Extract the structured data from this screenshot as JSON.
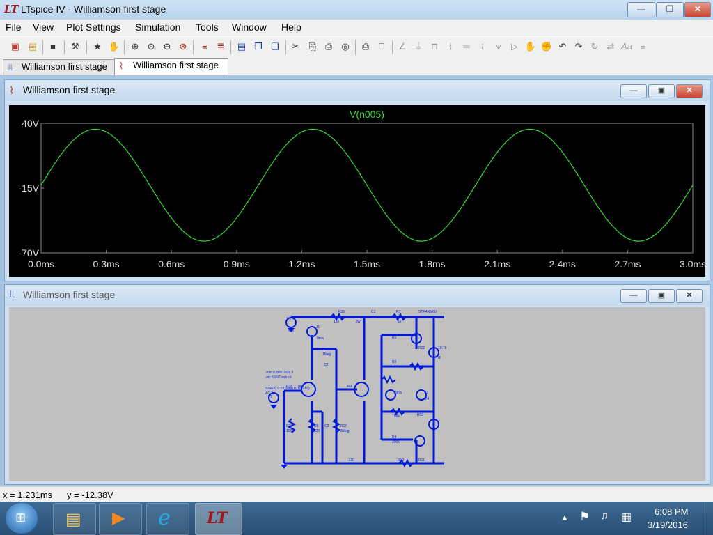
{
  "window": {
    "title": "LTspice IV - Williamson first stage",
    "logo": "LT"
  },
  "menu": [
    "File",
    "View",
    "Plot Settings",
    "Simulation",
    "Tools",
    "Window",
    "Help"
  ],
  "tabs": [
    {
      "label": "Williamson first stage",
      "icon": "schematic-icon",
      "active": false
    },
    {
      "label": "Williamson first stage",
      "icon": "waveform-icon",
      "active": true
    }
  ],
  "plot_window": {
    "title": "Williamson first stage"
  },
  "schematic_window": {
    "title": "Williamson first stage"
  },
  "chart_data": {
    "type": "line",
    "title": "V(n005)",
    "xlabel": "",
    "ylabel": "",
    "xlim": [
      0.0,
      3.0
    ],
    "ylim": [
      -70,
      40
    ],
    "x_ticks": [
      "0.0ms",
      "0.3ms",
      "0.6ms",
      "0.9ms",
      "1.2ms",
      "1.5ms",
      "1.8ms",
      "2.1ms",
      "2.4ms",
      "2.7ms",
      "3.0ms"
    ],
    "y_ticks": [
      "40V",
      "-15V",
      "-70V"
    ],
    "grid": false,
    "series": [
      {
        "name": "V(n005)",
        "color": "#33dd33",
        "x": [
          0.0,
          0.25,
          0.5,
          0.75,
          1.0,
          1.25,
          1.5,
          1.75,
          2.0,
          2.25,
          2.5,
          2.75,
          3.0
        ],
        "y": [
          -12.4,
          35.0,
          -12.4,
          -60.0,
          -12.4,
          35.0,
          -12.4,
          -60.0,
          -12.4,
          35.0,
          -12.4,
          -60.0,
          -12.4
        ]
      }
    ]
  },
  "schematic": {
    "directives": [
      ".tran 0.000 .003 .1",
      ".inc 6SN7.sub.cir",
      "SINE(0 0.03 1000 0 0 0 210)",
      "AC 1"
    ],
    "labels": [
      "V1",
      "450",
      "I1",
      "9ma",
      "R35",
      "12k",
      "2w",
      "C1",
      "R7",
      "1k",
      "STP4NM60",
      "R12",
      "1Meg",
      "C2",
      "R18",
      "1k",
      "V2",
      "R13",
      "100k",
      "R6",
      "820",
      "C3",
      "R17",
      "8Meg",
      "R3",
      "R5",
      "R9",
      "150k",
      "R4",
      "200k",
      "R33",
      "10.7k",
      "I2",
      "5ma",
      "V3",
      "V4",
      "-120",
      "R10",
      "R11",
      "R22"
    ]
  },
  "status": {
    "x": "x = 1.231ms",
    "y": "y = -12.38V"
  },
  "tray": {
    "time": "6:08 PM",
    "date": "3/19/2016"
  },
  "colors": {
    "trace": "#33dd33",
    "plot_bg": "#000000",
    "wire": "#0018d8",
    "axis_text": "#e0e0e0"
  }
}
